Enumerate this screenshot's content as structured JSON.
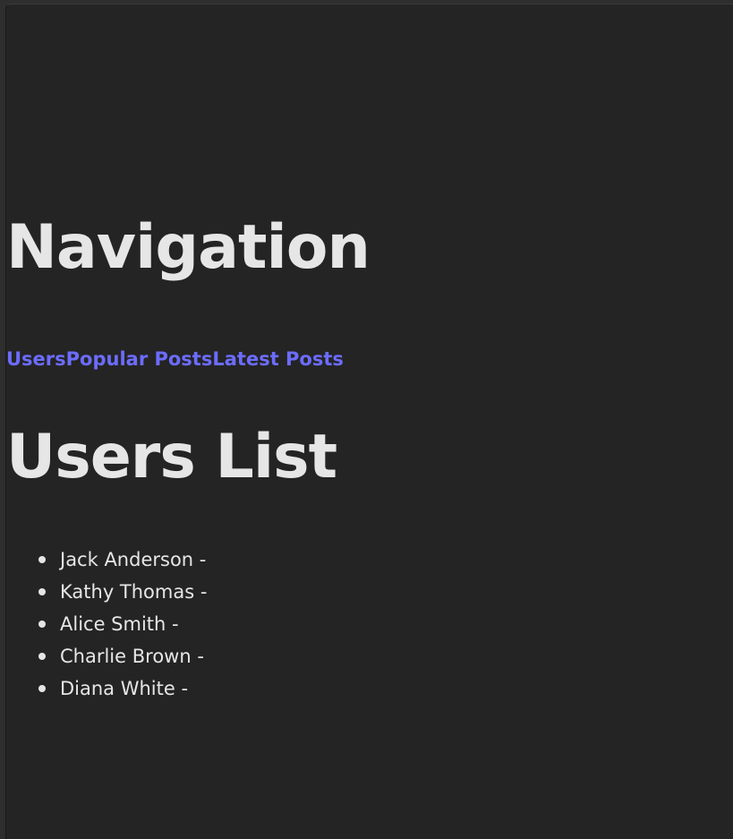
{
  "navigation": {
    "heading": "Navigation",
    "links": [
      "Users",
      "Popular Posts",
      "Latest Posts"
    ]
  },
  "users": {
    "heading": "Users List",
    "items": [
      "Jack Anderson -",
      "Kathy Thomas -",
      "Alice Smith -",
      "Charlie Brown -",
      "Diana White -"
    ]
  },
  "colors": {
    "background": "#242424",
    "text": "#e6e6e6",
    "link": "#6c6cff"
  }
}
